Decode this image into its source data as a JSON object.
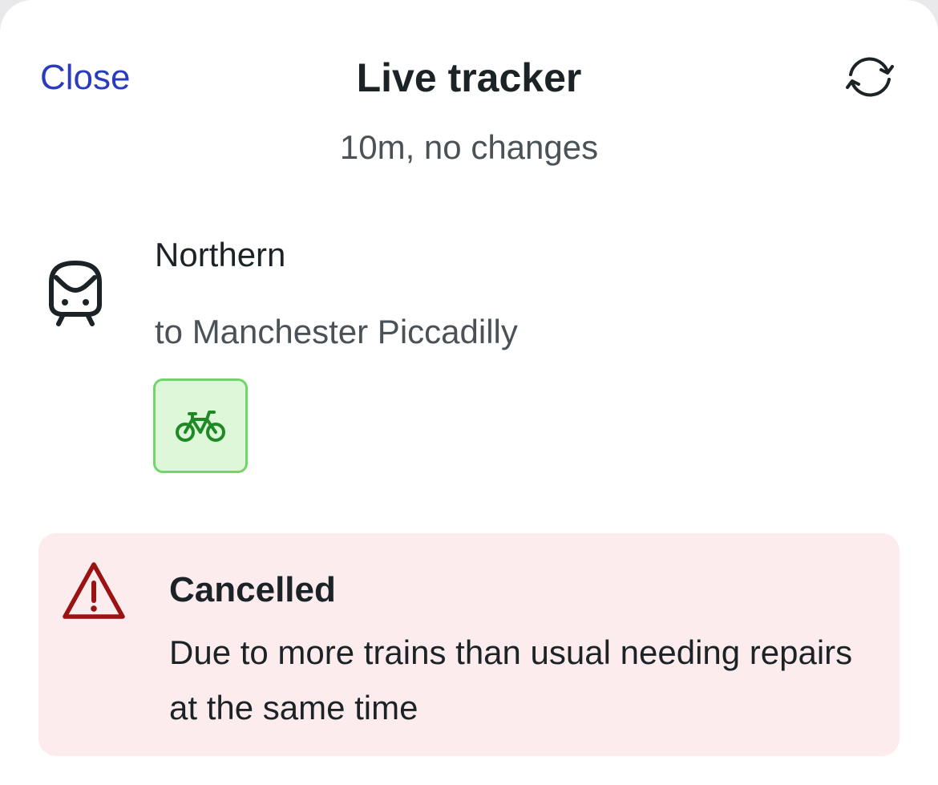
{
  "header": {
    "close_label": "Close",
    "title": "Live tracker",
    "refresh_icon": "refresh-icon"
  },
  "journey": {
    "summary": "10m, no changes",
    "mode_icon": "train-icon",
    "operator": "Northern",
    "destination": "to Manchester Piccadilly",
    "amenity_icon": "bicycle-icon",
    "amenity_color": "#1e8a26"
  },
  "alert": {
    "icon": "warning-icon",
    "title": "Cancelled",
    "message": "Due to more trains than usual needing repairs at the same time",
    "accent_color": "#9b1212",
    "background_color": "#fdeced"
  },
  "colors": {
    "link": "#2b3bbd",
    "text_primary": "#1c2326",
    "text_secondary": "#4a5257"
  }
}
